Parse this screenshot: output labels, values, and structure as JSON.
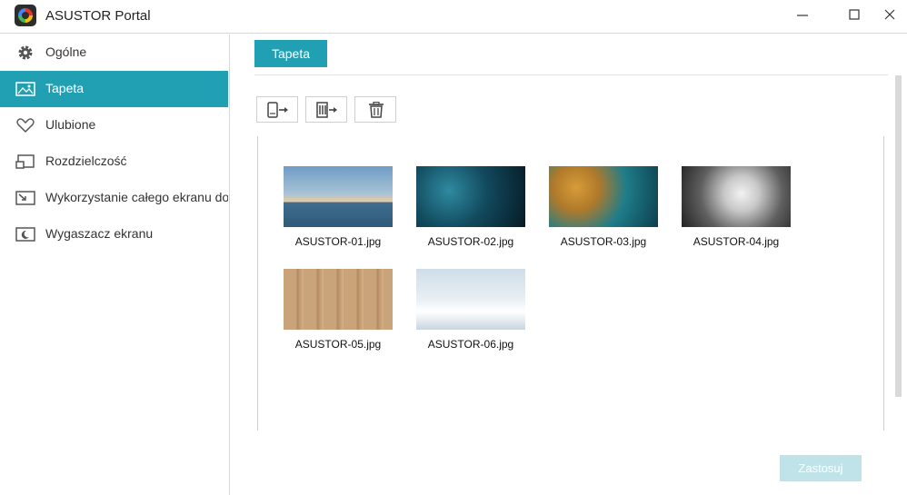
{
  "window": {
    "title": "ASUSTOR Portal"
  },
  "sidebar": {
    "items": [
      {
        "label": "Ogólne",
        "icon": "gear-icon",
        "active": false
      },
      {
        "label": "Tapeta",
        "icon": "image-icon",
        "active": true
      },
      {
        "label": "Ulubione",
        "icon": "heart-icon",
        "active": false
      },
      {
        "label": "Rozdzielczość",
        "icon": "resolution-icon",
        "active": false
      },
      {
        "label": "Wykorzystanie całego ekranu do",
        "icon": "fullscreen-icon",
        "active": false
      },
      {
        "label": "Wygaszacz ekranu",
        "icon": "screensaver-icon",
        "active": false
      }
    ]
  },
  "main": {
    "tab_label": "Tapeta",
    "toolbar": {
      "icons": [
        "import-from-device-icon",
        "import-from-nas-icon",
        "trash-icon"
      ]
    },
    "images": [
      {
        "name": "ASUSTOR-01.jpg"
      },
      {
        "name": "ASUSTOR-02.jpg"
      },
      {
        "name": "ASUSTOR-03.jpg"
      },
      {
        "name": "ASUSTOR-04.jpg"
      },
      {
        "name": "ASUSTOR-05.jpg"
      },
      {
        "name": "ASUSTOR-06.jpg"
      }
    ],
    "apply_label": "Zastosuj"
  },
  "colors": {
    "accent": "#21a0b4",
    "apply_disabled": "#bfe3e9"
  }
}
